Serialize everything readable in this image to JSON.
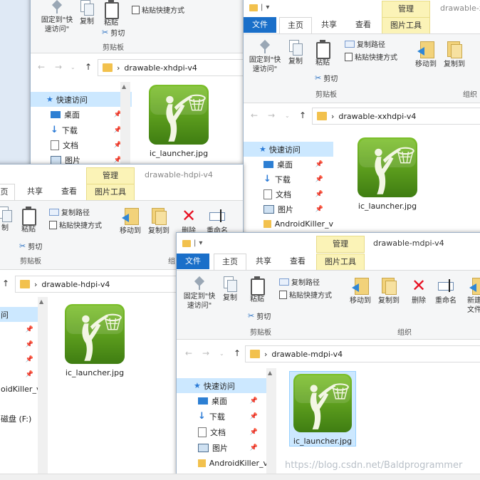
{
  "windows": {
    "xh": {
      "title": "",
      "folder": "drawable-xhdpi-v4",
      "ribbon": {
        "pin": "固定到\"快\n速访问\"",
        "copy": "复制",
        "paste": "粘贴",
        "paste_shortcut": "粘贴快捷方式",
        "cut": "剪切",
        "clipboard_group": "剪贴板"
      },
      "nav": {
        "quick_access": "快速访问",
        "desktop": "桌面",
        "downloads": "下载",
        "documents": "文档",
        "pictures": "图片"
      },
      "file": "ic_launcher.jpg"
    },
    "xxh": {
      "title": "drawable-x",
      "manage_tab": "管理",
      "tabs": {
        "file": "文件",
        "home": "主页",
        "share": "共享",
        "view": "查看",
        "picture_tools": "图片工具"
      },
      "ribbon": {
        "pin": "固定到\"快\n速访问\"",
        "copy": "复制",
        "paste": "粘贴",
        "copy_path": "复制路径",
        "paste_shortcut": "粘贴快捷方式",
        "cut": "剪切",
        "move_to": "移动到",
        "copy_to": "复制到",
        "clipboard_group": "剪贴板",
        "organize_group": "组织"
      },
      "folder": "drawable-xxhdpi-v4",
      "nav": {
        "quick_access": "快速访问",
        "desktop": "桌面",
        "downloads": "下载",
        "documents": "文档",
        "pictures": "图片",
        "androidkiller": "AndroidKiller_v"
      },
      "file": "ic_launcher.jpg"
    },
    "h": {
      "title": "drawable-hdpi-v4",
      "manage_tab": "管理",
      "tabs": {
        "home": "页",
        "share": "共享",
        "view": "查看",
        "picture_tools": "图片工具"
      },
      "ribbon": {
        "copy": "制",
        "paste": "粘贴",
        "copy_path": "复制路径",
        "paste_shortcut": "粘贴快捷方式",
        "cut": "剪切",
        "move_to": "移动到",
        "copy_to": "复制到",
        "delete": "删除",
        "rename": "重命名",
        "clipboard_group": "剪贴板",
        "organize_group": "组"
      },
      "folder": "drawable-hdpi-v4",
      "nav": {
        "quick_access": "问",
        "androidkiller": "oidKiller_v",
        "drive": "磁盘 (F:)"
      },
      "file": "ic_launcher.jpg"
    },
    "m": {
      "title": "drawable-mdpi-v4",
      "manage_tab": "管理",
      "tabs": {
        "file": "文件",
        "home": "主页",
        "share": "共享",
        "view": "查看",
        "picture_tools": "图片工具"
      },
      "ribbon": {
        "pin": "固定到\"快\n速访问\"",
        "copy": "复制",
        "paste": "粘贴",
        "copy_path": "复制路径",
        "paste_shortcut": "粘贴快捷方式",
        "cut": "剪切",
        "move_to": "移动到",
        "copy_to": "复制到",
        "delete": "删除",
        "rename": "重命名",
        "new_folder": "新建\n文件",
        "clipboard_group": "剪贴板",
        "organize_group": "组织"
      },
      "folder": "drawable-mdpi-v4",
      "nav": {
        "quick_access": "快速访问",
        "desktop": "桌面",
        "downloads": "下载",
        "documents": "文档",
        "pictures": "图片",
        "androidkiller": "AndroidKiller_v"
      },
      "file": "ic_launcher.jpg"
    }
  },
  "watermark": "https://blog.csdn.net/Baldprogrammer",
  "colors": {
    "file_tab": "#1a6fc9",
    "manage_tab": "#fbf3b7",
    "selection": "#cce8ff",
    "icon_green": "#5a9a1a",
    "delete_red": "#e81123"
  }
}
